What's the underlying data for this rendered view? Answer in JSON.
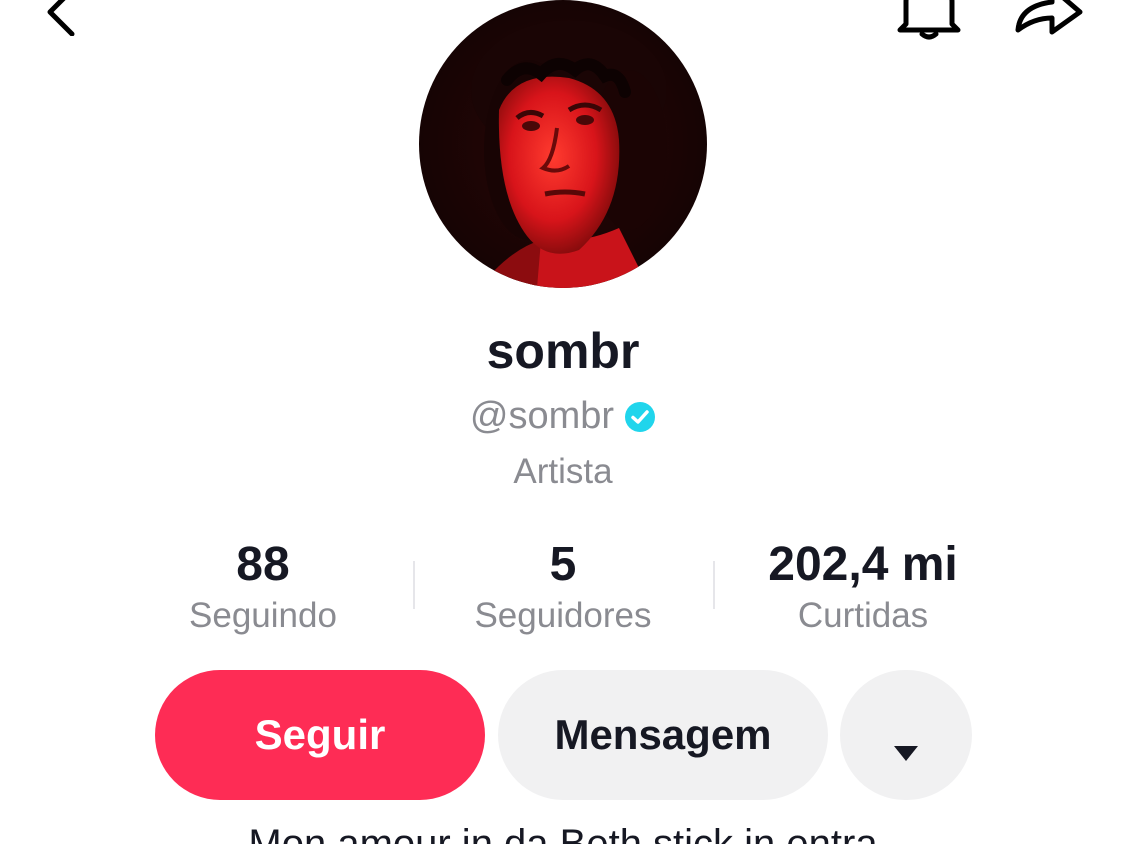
{
  "header": {
    "back_icon": "chevron-left-icon",
    "bell_icon": "bell-icon",
    "share_icon": "share-arrow-icon"
  },
  "profile": {
    "display_name": "sombr",
    "handle": "@sombr",
    "verified": true,
    "category": "Artista"
  },
  "stats": [
    {
      "value": "88",
      "label": "Seguindo"
    },
    {
      "value": "5",
      "label": "Seguidores"
    },
    {
      "value": "202,4 mi",
      "label": "Curtidas"
    }
  ],
  "actions": {
    "follow_label": "Seguir",
    "message_label": "Mensagem",
    "more_icon": "caret-down-icon"
  },
  "bio": {
    "text": "Mon amour in da Beth stick in entra"
  },
  "colors": {
    "accent": "#fe2c55",
    "verified": "#20d5ec",
    "secondary_text": "#8a8b91",
    "button_gray": "#f1f1f2"
  }
}
